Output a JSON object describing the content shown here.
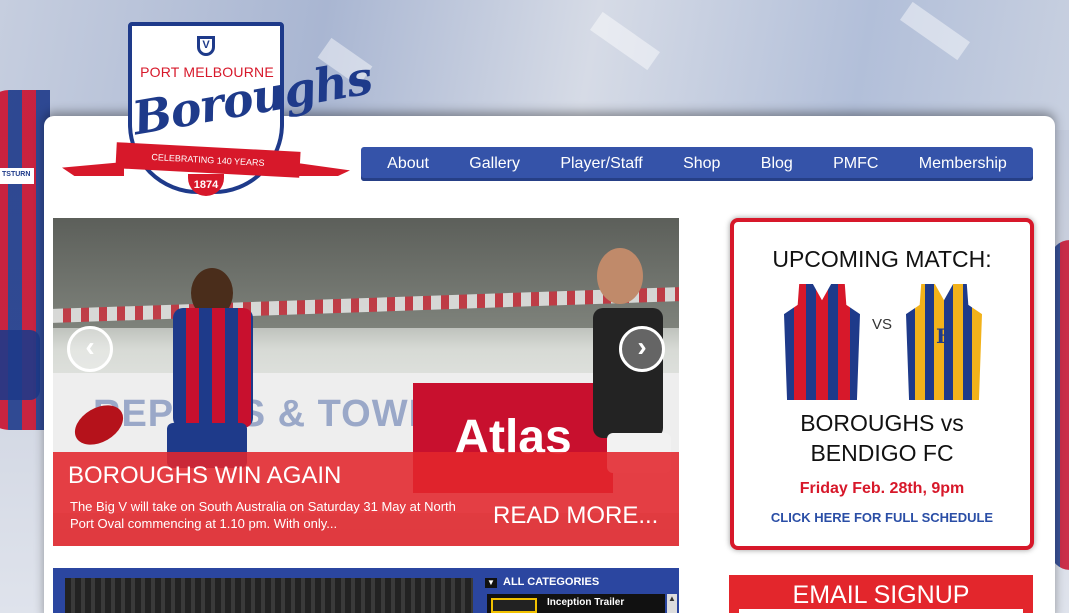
{
  "logo": {
    "top_text": "PORT MELBOURNE",
    "script_text": "Boroughs",
    "ribbon_text": "CELEBRATING 140 YEARS",
    "year": "1874",
    "v_mark": "V"
  },
  "background": {
    "sponsor_text": "TSTURN"
  },
  "nav": {
    "items": [
      {
        "label": "About"
      },
      {
        "label": "Gallery"
      },
      {
        "label": "Player/Staff"
      },
      {
        "label": "Shop"
      },
      {
        "label": "Blog"
      },
      {
        "label": "PMFC"
      },
      {
        "label": "Membership"
      }
    ]
  },
  "slider": {
    "title": "BOROUGHS WIN AGAIN",
    "text": "The Big V will take on South Australia on Saturday 31  May at North Port Oval commencing at 1.10 pm. With only...",
    "read_more": "READ MORE...",
    "prev_icon": "chevron-left-icon",
    "next_icon": "chevron-right-icon",
    "sign_text": "Atlas",
    "sign_left_text": "REPAIRS & TOWING"
  },
  "upcoming_match": {
    "heading": "UPCOMING MATCH:",
    "vs": "VS",
    "teams_line1": "BOROUGHS vs",
    "teams_line2": "BENDIGO FC",
    "date": "Friday Feb. 28th, 9pm",
    "schedule_link": "CLICK HERE FOR FULL SCHEDULE",
    "away_logo_text": "B"
  },
  "video": {
    "categories_label": "ALL CATEGORIES",
    "first_item": "Inception Trailer"
  },
  "email_signup": {
    "title": "EMAIL SIGNUP"
  },
  "colors": {
    "brand_blue": "#1e3a8a",
    "nav_blue": "#3553a9",
    "brand_red": "#d7182a",
    "gold": "#f2b21a"
  }
}
